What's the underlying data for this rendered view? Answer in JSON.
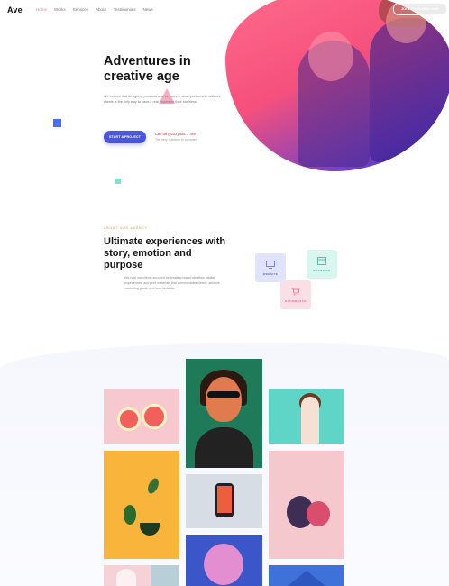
{
  "header": {
    "logo": "Ave",
    "nav": [
      "Home",
      "Works",
      "Services",
      "About",
      "Testimonials",
      "News"
    ],
    "cta_label": "JOIN TO DOWNLOAD"
  },
  "hero": {
    "title": "Adventures in creative age",
    "description": "We believe that designing products and services in close partnership with our clients is the only way to have a real impact on their business.",
    "button_label": "START A PROJECT",
    "phone": "Call us (0123) 456 – 789",
    "phone_sub": "The very question to consider"
  },
  "section2": {
    "eyebrow": "ABOUT OUR AGENCY",
    "title": "Ultimate experiences with story, emotion and purpose",
    "description": "We help our clients succeed by creating brand identities, digital experiences, and print materials that communicate clearly, achieve marketing goals, and look fantastic.",
    "cards": [
      {
        "label": "WEBSITE",
        "icon": "monitor-icon",
        "color": "#5c68e0"
      },
      {
        "label": "BRANDING",
        "icon": "browser-icon",
        "color": "#2fb59b"
      },
      {
        "label": "ECOMMERCE",
        "icon": "cart-icon",
        "color": "#ec6a87"
      }
    ]
  },
  "colors": {
    "accent": "#4b55e0",
    "pink": "#f25a7a",
    "teal": "#2fb59b"
  }
}
